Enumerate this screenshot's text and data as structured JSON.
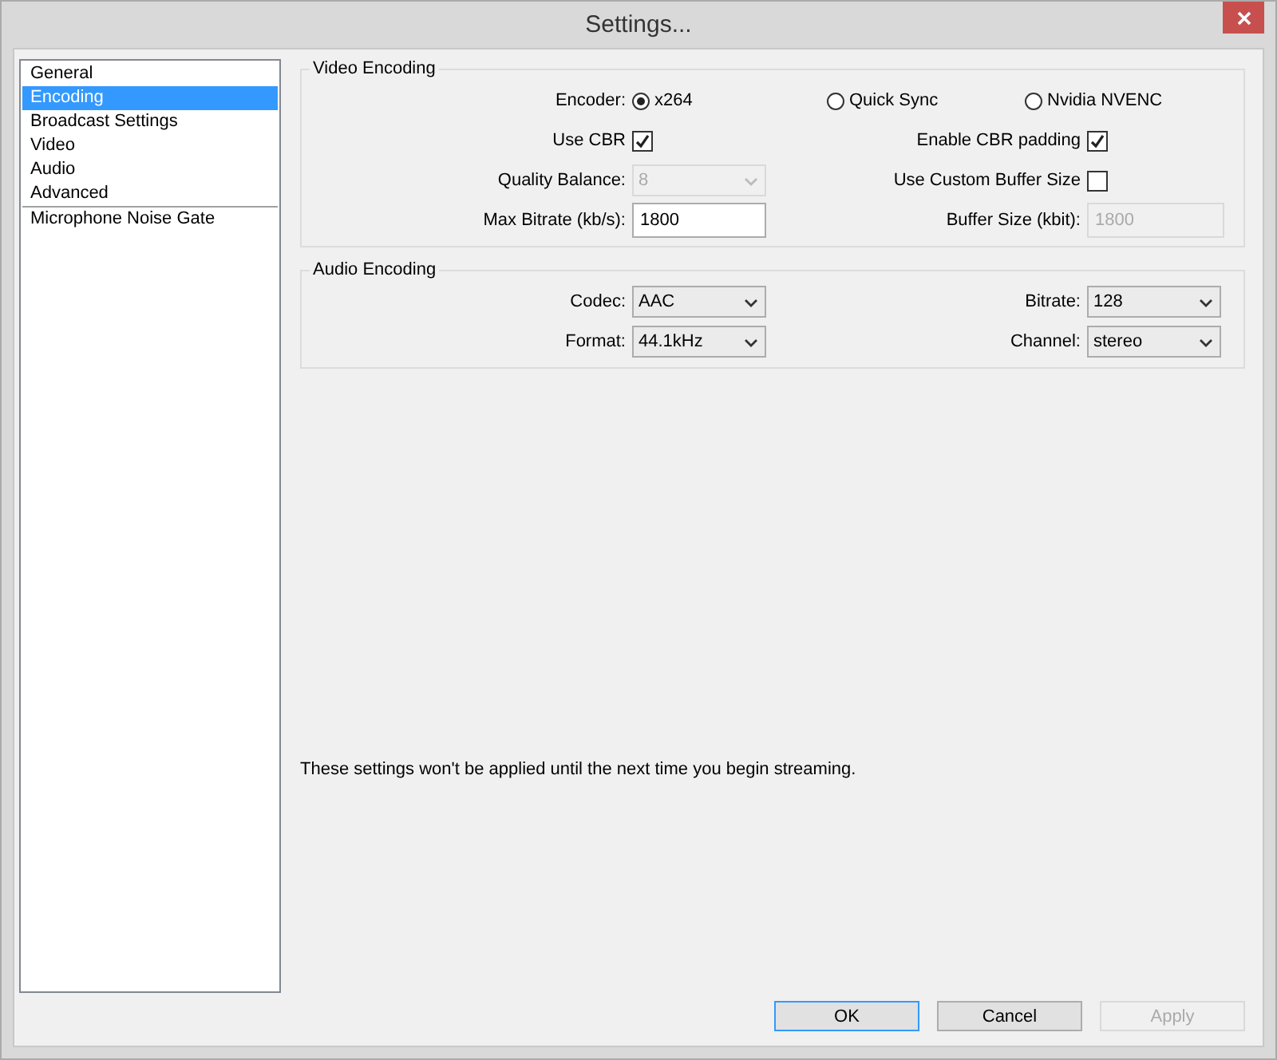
{
  "window": {
    "title": "Settings..."
  },
  "sidebar": {
    "items": [
      {
        "label": "General",
        "selected": false
      },
      {
        "label": "Encoding",
        "selected": true
      },
      {
        "label": "Broadcast Settings",
        "selected": false
      },
      {
        "label": "Video",
        "selected": false
      },
      {
        "label": "Audio",
        "selected": false
      },
      {
        "label": "Advanced",
        "selected": false
      }
    ],
    "plugins": [
      {
        "label": "Microphone Noise Gate",
        "selected": false
      }
    ]
  },
  "video_encoding": {
    "title": "Video Encoding",
    "encoder_label": "Encoder:",
    "encoders": [
      {
        "label": "x264",
        "selected": true
      },
      {
        "label": "Quick Sync",
        "selected": false
      },
      {
        "label": "Nvidia NVENC",
        "selected": false
      }
    ],
    "use_cbr": {
      "label": "Use CBR",
      "checked": true
    },
    "cbr_padding": {
      "label": "Enable CBR padding",
      "checked": true
    },
    "quality_balance": {
      "label": "Quality Balance:",
      "value": "8",
      "disabled": true
    },
    "custom_buffer": {
      "label": "Use Custom Buffer Size",
      "checked": false
    },
    "max_bitrate": {
      "label": "Max Bitrate (kb/s):",
      "value": "1800",
      "disabled": false
    },
    "buffer_size": {
      "label": "Buffer Size (kbit):",
      "value": "1800",
      "disabled": true
    }
  },
  "audio_encoding": {
    "title": "Audio Encoding",
    "fields": [
      {
        "label": "Codec:",
        "value": "AAC"
      },
      {
        "label": "Bitrate:",
        "value": "128"
      },
      {
        "label": "Format:",
        "value": "44.1kHz"
      },
      {
        "label": "Channel:",
        "value": "stereo"
      }
    ]
  },
  "note": "These settings won't be applied until the next time you begin streaming.",
  "buttons": [
    {
      "label": "OK",
      "default": true,
      "disabled": false
    },
    {
      "label": "Cancel",
      "default": false,
      "disabled": false
    },
    {
      "label": "Apply",
      "default": false,
      "disabled": true
    }
  ]
}
